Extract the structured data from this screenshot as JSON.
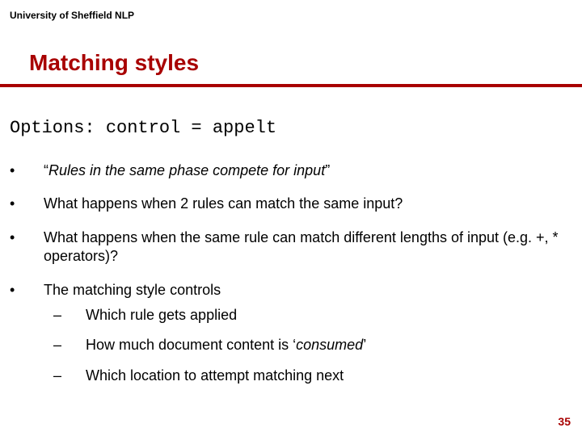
{
  "header": "University of Sheffield NLP",
  "title": "Matching styles",
  "code_line": "Options: control = appelt",
  "bullets": {
    "b1_pre": "“",
    "b1_italic": "Rules in the same phase compete for input",
    "b1_post": "”",
    "b2": "What happens when 2 rules can match the same input?",
    "b3": "What happens when the same rule can match different lengths of input (e.g. +, * operators)?",
    "b4": "The matching style controls"
  },
  "sub": {
    "s1": "Which rule gets applied",
    "s2_pre": "How much document content is ‘",
    "s2_italic": "consumed",
    "s2_post": "’",
    "s3": "Which location to attempt matching next"
  },
  "marks": {
    "bullet": "•",
    "dash": "–"
  },
  "page_number": "35"
}
